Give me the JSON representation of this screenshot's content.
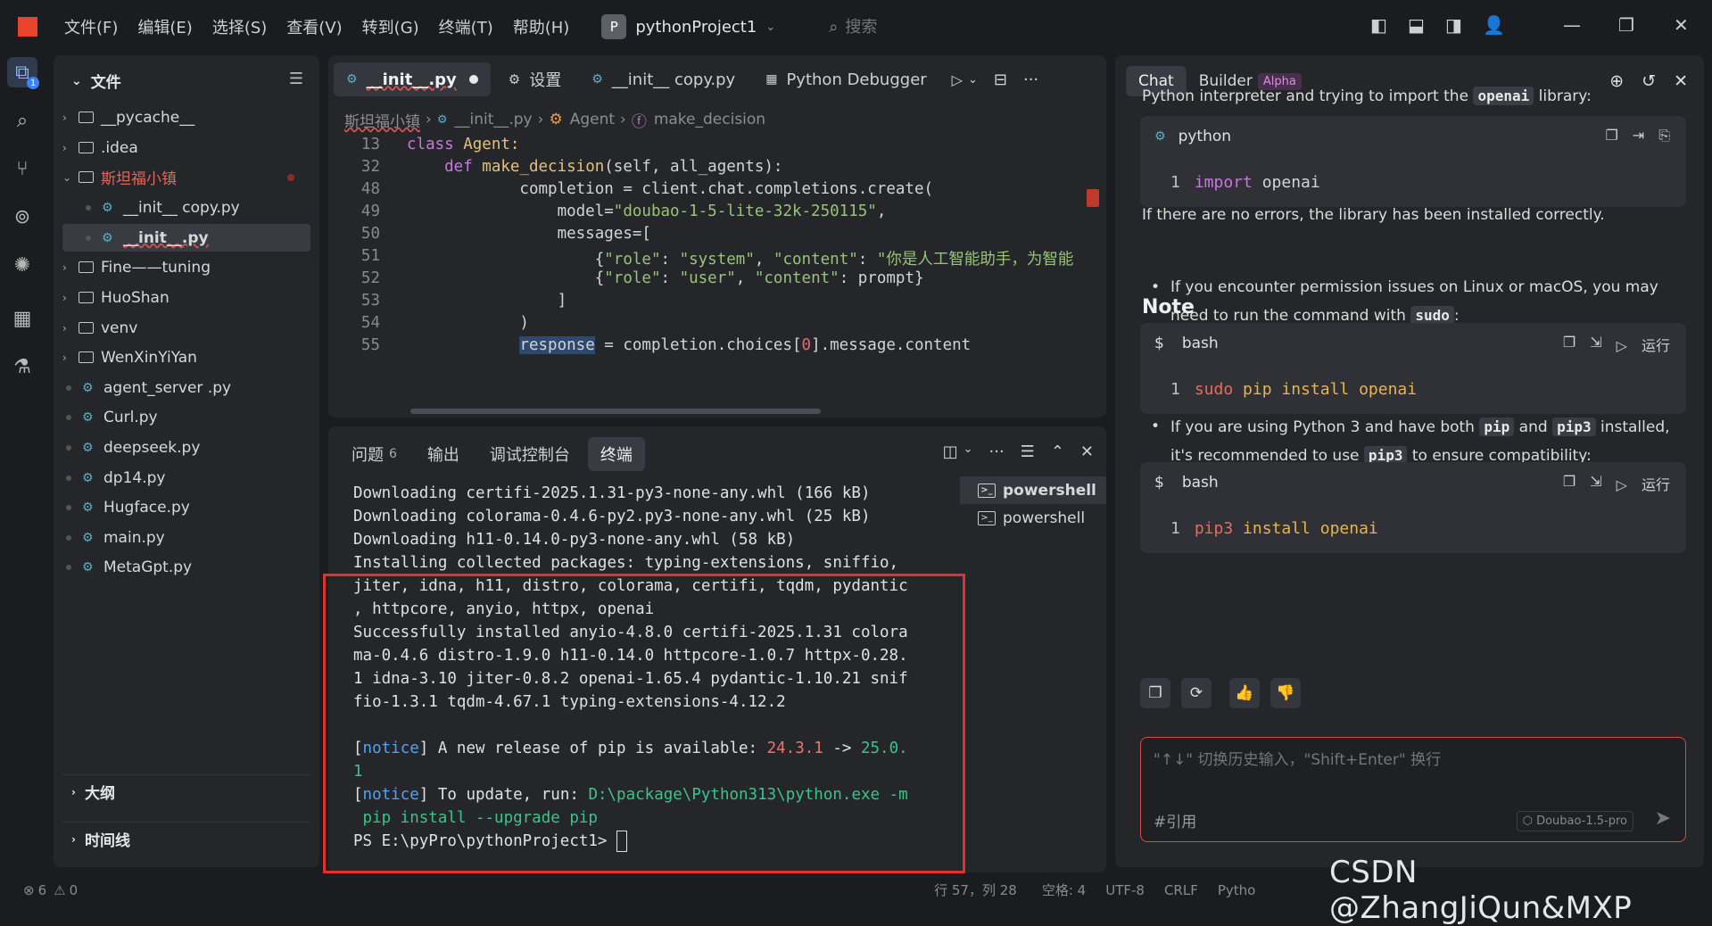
{
  "titlebar": {
    "menu": [
      "文件(F)",
      "编辑(E)",
      "选择(S)",
      "查看(V)",
      "转到(G)",
      "终端(T)",
      "帮助(H)"
    ],
    "project_badge": "P",
    "project_name": "pythonProject1",
    "search_placeholder": "搜索"
  },
  "activity": {
    "explorer_badge": "1"
  },
  "explorer": {
    "title": "文件",
    "items": [
      {
        "label": "__pycache__"
      },
      {
        "label": ".idea"
      },
      {
        "label": "斯坦福小镇"
      },
      {
        "label": "__init__ copy.py"
      },
      {
        "label": "__init__.py"
      },
      {
        "label": "Fine——tuning"
      },
      {
        "label": "HuoShan"
      },
      {
        "label": "venv"
      },
      {
        "label": "WenXinYiYan"
      },
      {
        "label": "agent_server .py"
      },
      {
        "label": "Curl.py"
      },
      {
        "label": "deepseek.py"
      },
      {
        "label": "dp14.py"
      },
      {
        "label": "Hugface.py"
      },
      {
        "label": "main.py"
      },
      {
        "label": "MetaGpt.py"
      }
    ],
    "outline": "大纲",
    "timeline": "时间线"
  },
  "editor": {
    "tabs": [
      "__init__.py",
      "设置",
      "__init__ copy.py",
      "Python Debugger"
    ],
    "breadcrumb": [
      "斯坦福小镇",
      "__init__.py",
      "Agent",
      "make_decision"
    ],
    "lines": {
      "n13": "13",
      "n32": "32",
      "n48": "48",
      "n49": "49",
      "n50": "50",
      "n51": "51",
      "n52": "52",
      "n53": "53",
      "n54": "54",
      "n55": "55",
      "l13a": "class ",
      "l13b": "Agent:",
      "l32a": "    def ",
      "l32b": "make_decision",
      "l32c": "(self, all_agents):",
      "l48": "            completion = client.chat.completions.create(",
      "l49a": "                model=",
      "l49b": "\"doubao-1-5-lite-32k-250115\"",
      "l49c": ",",
      "l50": "                messages=[",
      "l51a": "                    {",
      "l51b": "\"role\"",
      "l51c": ": ",
      "l51d": "\"system\"",
      "l51e": ", ",
      "l51f": "\"content\"",
      "l51g": ": ",
      "l51h": "\"你是人工智能助手，为智能",
      "l52a": "                    {",
      "l52b": "\"role\"",
      "l52c": ": ",
      "l52d": "\"user\"",
      "l52e": ", ",
      "l52f": "\"content\"",
      "l52g": ": prompt}",
      "l53": "                ]",
      "l54": "            )",
      "l55a": "            ",
      "l55b": "response",
      "l55c": " = completion.choices[",
      "l55d": "0",
      "l55e": "].message.content"
    }
  },
  "panel": {
    "tabs": [
      "问题",
      "输出",
      "调试控制台",
      "终端"
    ],
    "problems_count": "6",
    "terminal": {
      "t1": "Downloading certifi-2025.1.31-py3-none-any.whl (166 kB)",
      "t2": "Downloading colorama-0.4.6-py2.py3-none-any.whl (25 kB)",
      "t3": "Downloading h11-0.14.0-py3-none-any.whl (58 kB)",
      "t4": "Installing collected packages: typing-extensions, sniffio,",
      "t5": "jiter, idna, h11, distro, colorama, certifi, tqdm, pydantic",
      "t6": ", httpcore, anyio, httpx, openai",
      "t7": "Successfully installed anyio-4.8.0 certifi-2025.1.31 colora",
      "t8": "ma-0.4.6 distro-1.9.0 h11-0.14.0 httpcore-1.0.7 httpx-0.28.",
      "t9": "1 idna-3.10 jiter-0.8.2 openai-1.65.4 pydantic-1.10.21 snif",
      "t10": "fio-1.3.1 tqdm-4.67.1 typing-extensions-4.12.2",
      "notice": "notice",
      "n1a": " A new release of pip is available: ",
      "n1b": "24.3.1",
      "n1c": " -> ",
      "n1d": "25.0.",
      "n1e": "1",
      "n2a": " To update, run: ",
      "n2b": "D:\\package\\Python313\\python.exe -m",
      "n2c": " pip install --upgrade pip",
      "prompt": "PS E:\\pyPro\\pythonProject1> "
    },
    "terminals": [
      "powershell",
      "powershell"
    ]
  },
  "chat": {
    "tabs": [
      "Chat",
      "Builder"
    ],
    "alpha": "Alpha",
    "p1a": "Python interpreter and trying to import the ",
    "p1b": "openai",
    "p1c": " library:",
    "card1": {
      "lang": "python",
      "lno": "1",
      "kw": "import",
      "rest": " openai"
    },
    "p2": "If there are no errors, the library has been installed correctly.",
    "note": "Note",
    "li1a": "If you encounter permission issues on Linux or macOS, you may need to run the command with ",
    "li1b": "sudo",
    "li1c": ":",
    "card2": {
      "lang": "bash",
      "run": "运行",
      "lno": "1",
      "cmd": "sudo",
      "args": " pip install openai"
    },
    "li2a": "If you are using Python 3 and have both ",
    "li2b": "pip",
    "li2c": " and ",
    "li2d": "pip3",
    "li2e": " installed, it's recommended to use ",
    "li2f": "pip3",
    "li2g": " to ensure compatibility:",
    "card3": {
      "lang": "bash",
      "run": "运行",
      "lno": "1",
      "cmd": "pip3",
      "args": " install openai"
    },
    "input_placeholder": "\"↑↓\" 切换历史输入，\"Shift+Enter\" 换行",
    "ref": "#引用",
    "model": "Doubao-1.5-pro"
  },
  "statusbar": {
    "errors": "6",
    "warnings": "0",
    "position": "行 57，列 28",
    "spaces": "空格: 4",
    "encoding": "UTF-8",
    "eol": "CRLF",
    "lang": "Pytho"
  },
  "watermark": "CSDN @ZhangJiQun&MXP"
}
